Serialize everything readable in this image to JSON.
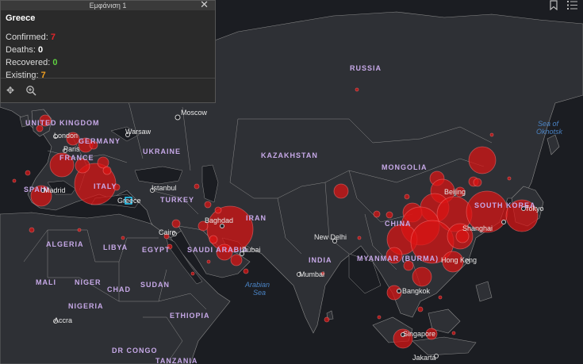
{
  "popup": {
    "header_title": "Εμφάνιση 1",
    "country": "Greece",
    "confirmed_label": "Confirmed:",
    "confirmed_value": "7",
    "deaths_label": "Deaths:",
    "deaths_value": "0",
    "recovered_label": "Recovered:",
    "recovered_value": "0",
    "existing_label": "Existing:",
    "existing_value": "7",
    "icons": [
      "close-icon",
      "pan-icon",
      "zoom-icon"
    ]
  },
  "top_tools": {
    "icons": [
      "bookmark-icon",
      "list-icon"
    ]
  },
  "colors": {
    "land": "#2e3035",
    "water": "#1b1d22",
    "bubble": "#dc1414",
    "confirmed": "#e3262a",
    "recovered": "#5fd040",
    "existing": "#f0a020",
    "country_label": "#c7a9e8",
    "sea_label": "#4a83c4"
  },
  "map": {
    "country_labels": [
      "RUSSIA",
      "KAZAKHSTAN",
      "MONGOLIA",
      "UKRAINE",
      "TURKEY",
      "IRAN",
      "SAUDI ARABIA",
      "EGYPT",
      "LIBYA",
      "ALGERIA",
      "MALI",
      "NIGER",
      "CHAD",
      "SUDAN",
      "ETHIOPIA",
      "NIGERIA",
      "DR CONGO",
      "TANZANIA",
      "INDIA",
      "MYANMAR (BURMA)",
      "SOUTH KOREA",
      "UNITED KINGDOM",
      "FRANCE",
      "GERMANY",
      "ITALY",
      "SPAIN",
      "CHINA"
    ],
    "city_labels": [
      "Moscow",
      "Warsaw",
      "London",
      "Paris",
      "Madrid",
      "Istanbul",
      "Cairo",
      "Baghdad",
      "Dubai",
      "New Delhi",
      "Mumbai",
      "Bangkok",
      "Hong Kong",
      "Shanghai",
      "Tokyo",
      "Singapore",
      "Jakarta",
      "Accra",
      "Beijing",
      "Greece"
    ],
    "sea_labels": [
      "Sea of Okhotsk",
      "Arabian Sea"
    ]
  }
}
